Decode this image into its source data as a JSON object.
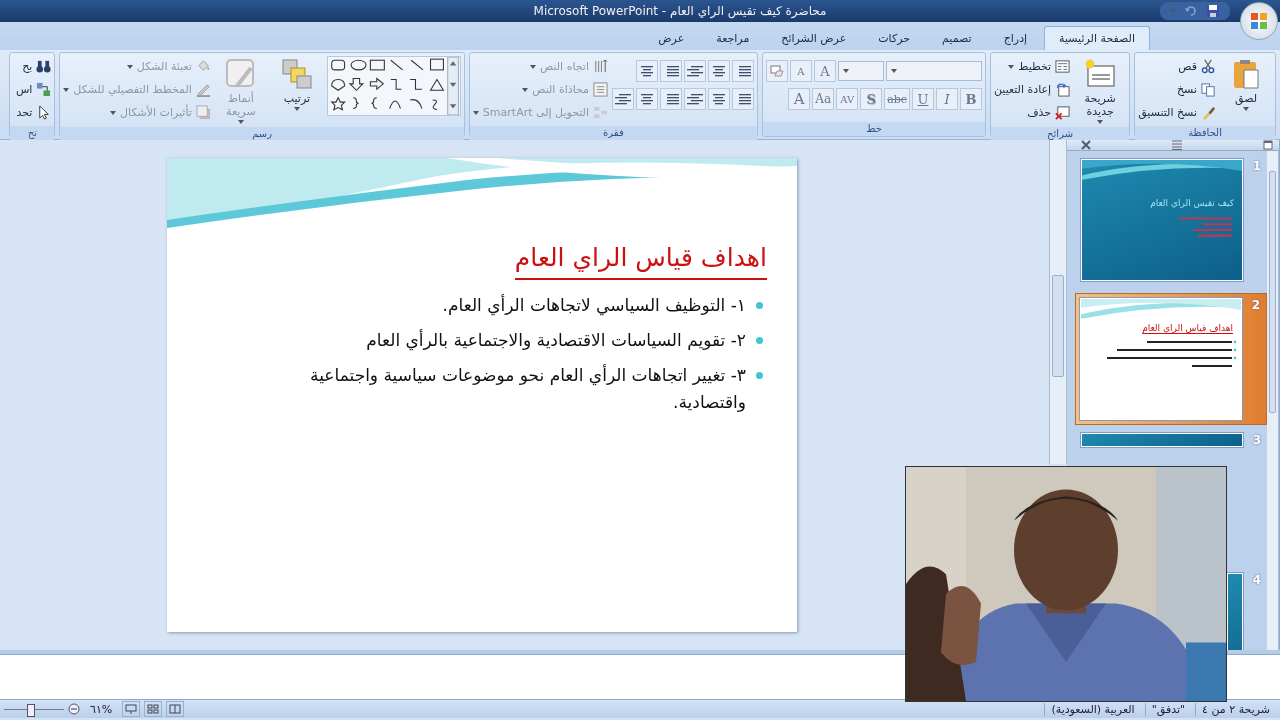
{
  "window": {
    "title": "محاضرة كيف تقيس الراي العام - Microsoft PowerPoint"
  },
  "tabs": [
    {
      "label": "الصفحة الرئيسية",
      "selected": true
    },
    {
      "label": "إدراج",
      "selected": false
    },
    {
      "label": "تصميم",
      "selected": false
    },
    {
      "label": "حركات",
      "selected": false
    },
    {
      "label": "عرض الشرائح",
      "selected": false
    },
    {
      "label": "مراجعة",
      "selected": false
    },
    {
      "label": "عرض",
      "selected": false
    }
  ],
  "ribbon": {
    "groups": [
      {
        "kind": "clipboard",
        "label": "الحافظة",
        "large": {
          "label": "لصق"
        },
        "items": [
          {
            "label": "قص",
            "disabled": false
          },
          {
            "label": "نسخ",
            "disabled": false
          },
          {
            "label": "نسخ التنسيق",
            "disabled": false
          }
        ]
      },
      {
        "kind": "slides",
        "label": "شرائح",
        "large": {
          "label": "شريحة جديدة"
        },
        "items": [
          {
            "label": "تخطيط",
            "disabled": false
          },
          {
            "label": "إعادة التعيين",
            "disabled": false
          },
          {
            "label": "حذف",
            "disabled": false
          }
        ]
      },
      {
        "kind": "font",
        "label": "خط",
        "size_buttons": [
          {
            "label": "A"
          },
          {
            "label": "A"
          }
        ],
        "style_buttons": [
          {
            "label": "B"
          },
          {
            "label": "I"
          },
          {
            "label": "U"
          },
          {
            "label": "abc"
          },
          {
            "label": "S"
          },
          {
            "label": "AV"
          },
          {
            "label": "Aa"
          },
          {
            "label": "A"
          }
        ]
      },
      {
        "kind": "paragraph",
        "label": "فقرة",
        "items": [
          {
            "label": "اتجاه النص",
            "disabled": true
          },
          {
            "label": "محاذاة النص",
            "disabled": true
          },
          {
            "label": "التحويل إلى SmartArt",
            "disabled": true
          }
        ]
      },
      {
        "kind": "drawing",
        "label": "رسم",
        "large": {
          "label": "ترتيب"
        },
        "styles": {
          "label": "أنماط سريعة",
          "disabled": true
        },
        "items": [
          {
            "label": "تعبئة الشكل",
            "disabled": true
          },
          {
            "label": "المخطط التفصيلي للشكل",
            "disabled": true
          },
          {
            "label": "تأثيرات الأشكال",
            "disabled": true
          }
        ]
      },
      {
        "kind": "editing",
        "label": "تح",
        "items": [
          {
            "label": "بح",
            "disabled": false
          },
          {
            "label": "اس",
            "disabled": false
          },
          {
            "label": "تحد",
            "disabled": false
          }
        ]
      }
    ]
  },
  "slide": {
    "title": "اهداف قياس الراي العام",
    "bullets": [
      "١- التوظيف السياسي لاتجاهات الرأي العام.",
      "٢- تقويم السياسات الاقتصادية والاجتماعية بالرأي العام",
      "٣- تغيير اتجاهات الرأي العام نحو موضوعات سياسية واجتماعية واقتصادية."
    ]
  },
  "thumbnails": [
    {
      "number": "1",
      "selected": false,
      "kind": "title",
      "title": "كيف تقيس الراي العام"
    },
    {
      "number": "2",
      "selected": true,
      "kind": "content",
      "title": "اهداف قياس الراي العام"
    },
    {
      "number": "3",
      "selected": false,
      "kind": "title"
    },
    {
      "number": "4",
      "selected": false,
      "kind": "title"
    }
  ],
  "status_bar": {
    "slide": "شريحة ٢ من ٤",
    "theme": "\"تدفق\"",
    "language": "العربية (السعودية)",
    "zoom": "%٦١",
    "zoom_slider": {
      "level": 0.45
    }
  }
}
